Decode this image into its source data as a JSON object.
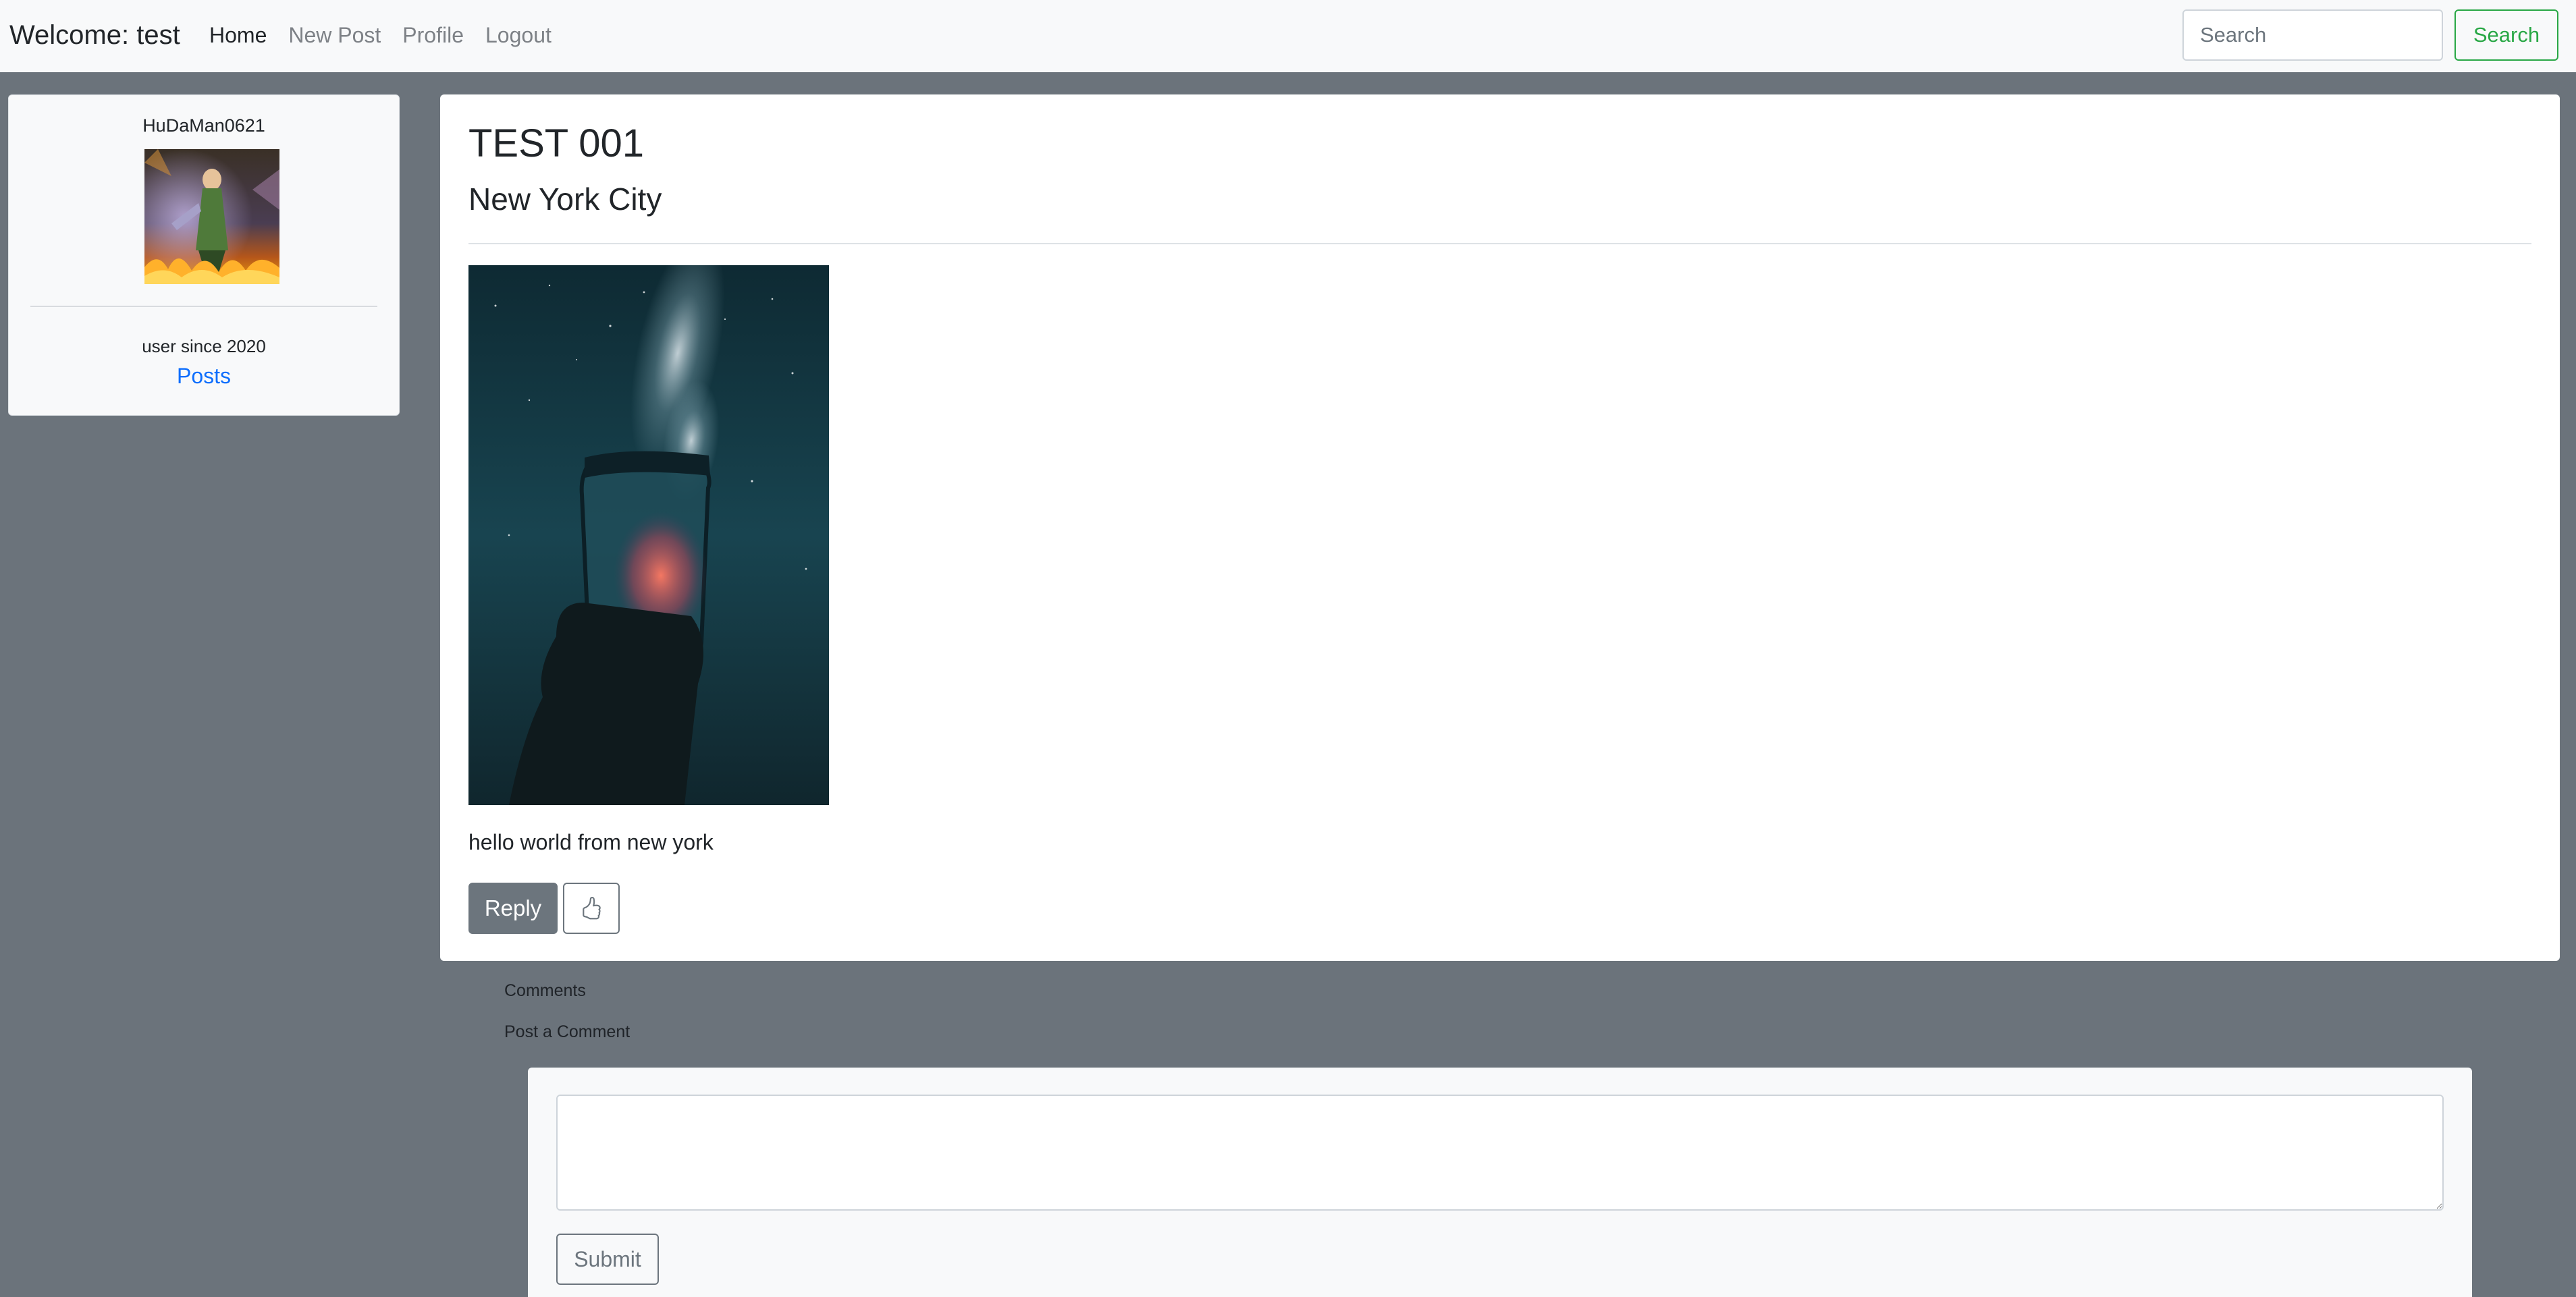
{
  "navbar": {
    "brand": "Welcome: test",
    "links": [
      {
        "label": "Home",
        "active": true
      },
      {
        "label": "New Post",
        "active": false
      },
      {
        "label": "Profile",
        "active": false
      },
      {
        "label": "Logout",
        "active": false
      }
    ],
    "search": {
      "placeholder": "Search",
      "value": "",
      "button_label": "Search"
    }
  },
  "profile": {
    "username": "HuDaMan0621",
    "avatar_icon": "avatar-image",
    "member_since": "user since 2020",
    "posts_link": "Posts"
  },
  "post": {
    "title": "TEST 001",
    "location": "New York City",
    "image_icon": "post-image",
    "body": "hello world from new york",
    "reply_label": "Reply",
    "like_icon": "thumbs-up-icon"
  },
  "comments": {
    "heading": "Comments",
    "post_heading": "Post a Comment",
    "textarea_value": "",
    "submit_label": "Submit"
  },
  "colors": {
    "page_bg": "#6b737b",
    "navbar_bg": "#f8f9fa",
    "search_green": "#28a745",
    "link_blue": "#0d6efd",
    "secondary": "#6c757d"
  }
}
